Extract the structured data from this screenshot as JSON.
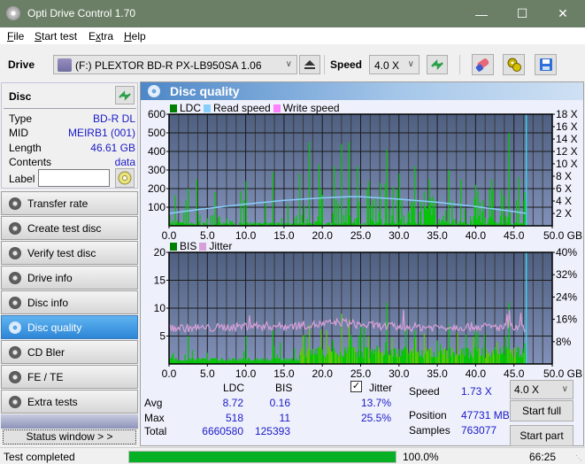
{
  "window": {
    "title": "Opti Drive Control 1.70",
    "controls": {
      "minimize": "—",
      "maximize": "☐",
      "close": "✕"
    }
  },
  "menu": [
    {
      "label": "File",
      "accel": "F",
      "rest": "ile"
    },
    {
      "label": "Start test",
      "accel": "S",
      "rest": "tart test"
    },
    {
      "label": "Extra",
      "accel": "x",
      "pre": "E",
      "rest": "tra"
    },
    {
      "label": "Help",
      "accel": "H",
      "rest": "elp"
    }
  ],
  "toolbar": {
    "drive_label": "Drive",
    "drive_value": "(F:)  PLEXTOR BD-R  PX-LB950SA 1.06",
    "speed_label": "Speed",
    "speed_value": "4.0 X",
    "icons": [
      "eject-icon",
      "refresh-swap-icon",
      "eraser-icon",
      "settings-gear-icon",
      "save-icon"
    ]
  },
  "disc": {
    "header": "Disc",
    "rows": [
      {
        "key": "Type",
        "value": "BD-R DL"
      },
      {
        "key": "MID",
        "value": "MEIRB1 (001)"
      },
      {
        "key": "Length",
        "value": "46.61 GB"
      },
      {
        "key": "Contents",
        "value": "data"
      }
    ],
    "label_key": "Label",
    "label_value": ""
  },
  "nav": [
    {
      "label": "Transfer rate",
      "active": false
    },
    {
      "label": "Create test disc",
      "active": false
    },
    {
      "label": "Verify test disc",
      "active": false
    },
    {
      "label": "Drive info",
      "active": false
    },
    {
      "label": "Disc info",
      "active": false
    },
    {
      "label": "Disc quality",
      "active": true
    },
    {
      "label": "CD Bler",
      "active": false
    },
    {
      "label": "FE / TE",
      "active": false
    },
    {
      "label": "Extra tests",
      "active": false
    }
  ],
  "status_window_button": "Status window > >",
  "panel": {
    "title": "Disc quality"
  },
  "colors": {
    "ldc": "#00c800",
    "ldc_legend": "#008000",
    "read_speed": "#87cefa",
    "write_speed": "#ff80ff",
    "bis": "#00c800",
    "jitter": "#d8a0d8",
    "accent_blue": "#1a1ac8",
    "progress": "#06b025"
  },
  "chart_data": [
    {
      "type": "bar",
      "title": "LDC / Read speed",
      "legend": [
        "LDC",
        "Read speed",
        "Write speed"
      ],
      "xlabel": "GB",
      "x_ticks": [
        "0.0",
        "5.0",
        "10.0",
        "15.0",
        "20.0",
        "25.0",
        "30.0",
        "35.0",
        "40.0",
        "45.0",
        "50.0 GB"
      ],
      "xlim": [
        0,
        50
      ],
      "y_ticks": [
        "100",
        "200",
        "300",
        "400",
        "500",
        "600"
      ],
      "ylim": [
        0,
        600
      ],
      "y2_ticks": [
        "2 X",
        "4 X",
        "6 X",
        "8 X",
        "10 X",
        "12 X",
        "14 X",
        "16 X",
        "18 X"
      ],
      "y2lim": [
        0,
        18
      ],
      "end_marker_gb": 46.61,
      "ldc_peaks": [
        {
          "x": 0.5,
          "y": 30
        },
        {
          "x": 2.5,
          "y": 200
        },
        {
          "x": 3.5,
          "y": 250
        },
        {
          "x": 5.0,
          "y": 40
        },
        {
          "x": 7.5,
          "y": 40
        },
        {
          "x": 10.0,
          "y": 240
        },
        {
          "x": 12.5,
          "y": 130
        },
        {
          "x": 13.5,
          "y": 290
        },
        {
          "x": 15.5,
          "y": 120
        },
        {
          "x": 17.0,
          "y": 280
        },
        {
          "x": 18.2,
          "y": 450
        },
        {
          "x": 19.5,
          "y": 330
        },
        {
          "x": 21.5,
          "y": 320
        },
        {
          "x": 22.5,
          "y": 440
        },
        {
          "x": 23.5,
          "y": 450
        },
        {
          "x": 24.5,
          "y": 320
        },
        {
          "x": 26.0,
          "y": 240
        },
        {
          "x": 27.5,
          "y": 230
        },
        {
          "x": 28.3,
          "y": 410
        },
        {
          "x": 30.0,
          "y": 280
        },
        {
          "x": 32.0,
          "y": 320
        },
        {
          "x": 34.0,
          "y": 250
        },
        {
          "x": 36.5,
          "y": 300
        },
        {
          "x": 38.0,
          "y": 250
        },
        {
          "x": 40.0,
          "y": 220
        },
        {
          "x": 42.0,
          "y": 250
        },
        {
          "x": 44.3,
          "y": 500
        },
        {
          "x": 45.5,
          "y": 260
        },
        {
          "x": 46.5,
          "y": 250
        }
      ],
      "read_speed": [
        {
          "x": 0,
          "y": 2.0
        },
        {
          "x": 5,
          "y": 2.8
        },
        {
          "x": 10,
          "y": 3.5
        },
        {
          "x": 15,
          "y": 4.1
        },
        {
          "x": 20,
          "y": 4.5
        },
        {
          "x": 23.5,
          "y": 4.7
        },
        {
          "x": 25,
          "y": 4.7
        },
        {
          "x": 30,
          "y": 4.3
        },
        {
          "x": 35,
          "y": 3.8
        },
        {
          "x": 40,
          "y": 3.1
        },
        {
          "x": 45,
          "y": 2.3
        },
        {
          "x": 46.6,
          "y": 2.0
        }
      ]
    },
    {
      "type": "bar",
      "title": "BIS / Jitter",
      "legend": [
        "BIS",
        "Jitter"
      ],
      "xlabel": "GB",
      "x_ticks": [
        "0.0",
        "5.0",
        "10.0",
        "15.0",
        "20.0",
        "25.0",
        "30.0",
        "35.0",
        "40.0",
        "45.0",
        "50.0 GB"
      ],
      "xlim": [
        0,
        50
      ],
      "y_ticks": [
        "5",
        "10",
        "15",
        "20"
      ],
      "ylim": [
        0,
        20
      ],
      "y2_ticks": [
        "8%",
        "16%",
        "24%",
        "32%",
        "40%"
      ],
      "y2lim": [
        0,
        40
      ],
      "end_marker_gb": 46.61,
      "bis_peaks": [
        {
          "x": 0.5,
          "y": 2
        },
        {
          "x": 2.5,
          "y": 5
        },
        {
          "x": 5,
          "y": 2
        },
        {
          "x": 10,
          "y": 5
        },
        {
          "x": 13.5,
          "y": 6
        },
        {
          "x": 18.2,
          "y": 7
        },
        {
          "x": 20.5,
          "y": 6
        },
        {
          "x": 22.5,
          "y": 9
        },
        {
          "x": 23.5,
          "y": 8
        },
        {
          "x": 25,
          "y": 7
        },
        {
          "x": 28.3,
          "y": 11
        },
        {
          "x": 32,
          "y": 6
        },
        {
          "x": 36.5,
          "y": 7
        },
        {
          "x": 40,
          "y": 6
        },
        {
          "x": 44.3,
          "y": 11
        },
        {
          "x": 46.5,
          "y": 6
        }
      ],
      "jitter_pct": [
        {
          "x": 0,
          "y": 13
        },
        {
          "x": 5,
          "y": 12.8
        },
        {
          "x": 10,
          "y": 13.6
        },
        {
          "x": 15,
          "y": 13.6
        },
        {
          "x": 20,
          "y": 14.2
        },
        {
          "x": 22.5,
          "y": 15
        },
        {
          "x": 25,
          "y": 14
        },
        {
          "x": 30,
          "y": 13.2
        },
        {
          "x": 35,
          "y": 13.2
        },
        {
          "x": 40,
          "y": 13.4
        },
        {
          "x": 45,
          "y": 13
        },
        {
          "x": 46.6,
          "y": 12.6
        }
      ]
    }
  ],
  "stats": {
    "col_ldc": "LDC",
    "col_bis": "BIS",
    "jitter_label": "Jitter",
    "jitter_checked": true,
    "rows": [
      {
        "label": "Avg",
        "ldc": "8.72",
        "bis": "0.16",
        "jitter": "13.7%"
      },
      {
        "label": "Max",
        "ldc": "518",
        "bis": "11",
        "jitter": "25.5%"
      },
      {
        "label": "Total",
        "ldc": "6660580",
        "bis": "125393",
        "jitter": ""
      }
    ],
    "speed_label": "Speed",
    "speed_value": "1.73 X",
    "position_label": "Position",
    "position_value": "47731 MB",
    "samples_label": "Samples",
    "samples_value": "763077",
    "speed_select": "4.0 X",
    "start_full": "Start full",
    "start_part": "Start part"
  },
  "statusbar": {
    "text": "Test completed",
    "progress_percent": 100.0,
    "progress_label": "100.0%",
    "elapsed": "66:25"
  }
}
